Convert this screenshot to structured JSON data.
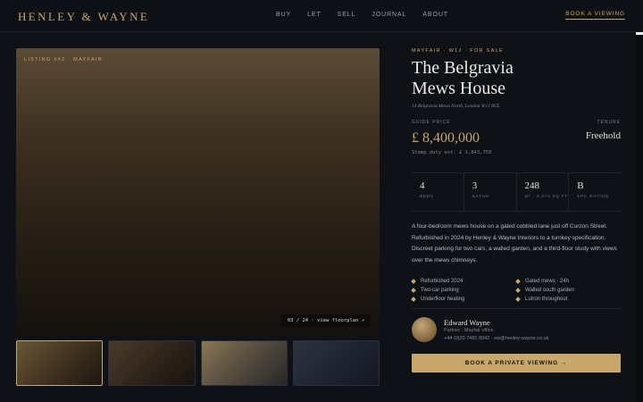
{
  "header": {
    "brand": "HENLEY & WAYNE",
    "nav": [
      "BUY",
      "LET",
      "SELL",
      "JOURNAL",
      "ABOUT"
    ],
    "cta_label": "BOOK A VIEWING"
  },
  "gallery": {
    "tag": "LISTING 042 · MAYFAIR",
    "counter": "03 / 24 · view floorplan ↗",
    "thumbnail_count": 4,
    "selected_thumbnail": 1
  },
  "listing": {
    "eyebrow": "MAYFAIR · W1J · FOR SALE",
    "title": "The Belgravia Mews House",
    "address": "14 Belgravia Mews North, London W1J 8GL",
    "guide_price_label": "GUIDE PRICE",
    "price": "£ 8,400,000",
    "stamp_duty": "Stamp duty est. £ 1,843,750",
    "tenure_label": "TENURE",
    "tenure": "Freehold",
    "stats": [
      {
        "value": "4",
        "label": "BEDS"
      },
      {
        "value": "3",
        "label": "BATHS"
      },
      {
        "value": "248",
        "label": "M² · 2,670 SQ FT"
      },
      {
        "value": "B",
        "label": "EPC RATING"
      }
    ],
    "description": "A four-bedroom mews house on a gated cobbled lane just off Curzon Street. Refurbished in 2024 by Henley & Wayne Interiors to a turnkey specification. Discreet parking for two cars, a walled garden, and a third-floor study with views over the mews chimneys.",
    "features": [
      "Refurbished 2024",
      "Gated mews · 24h",
      "Two-car parking",
      "Walled south garden",
      "Underfloor heating",
      "Lutron throughout"
    ]
  },
  "agent": {
    "name": "Edward Wayne",
    "role": "Partner · Mayfair office",
    "contact": "+44 (0)20 7491 0042 · ew@henley-wayne.co.uk"
  },
  "cta": {
    "label": "BOOK A PRIVATE VIEWING →"
  },
  "colors": {
    "accent": "#c8a76a",
    "background": "#0e1116"
  }
}
